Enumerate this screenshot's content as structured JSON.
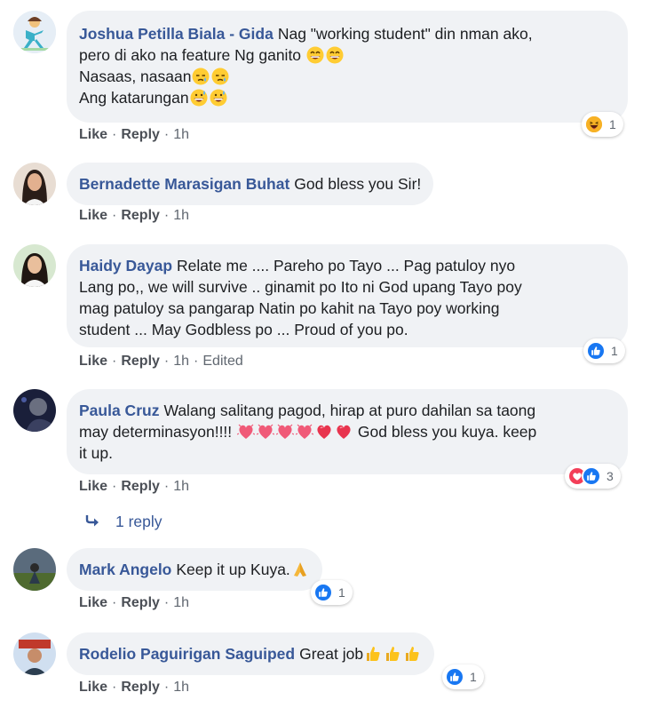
{
  "actions": {
    "like": "Like",
    "reply": "Reply",
    "edited": "Edited"
  },
  "comments": [
    {
      "author": "Joshua Petilla Biala - Gida",
      "lines": [
        "Nag \"working student\" din nman ako,",
        "pero di ako na feature Ng ganito",
        "Nasaas, nasaan",
        "Ang katarungan"
      ],
      "time": "1h",
      "reaction_count": "1",
      "reaction_types": [
        "haha"
      ]
    },
    {
      "author": "Bernadette Marasigan Buhat",
      "lines": [
        "God bless you Sir!"
      ],
      "time": "1h"
    },
    {
      "author": "Haidy Dayap",
      "lines": [
        "Relate me .... Pareho po Tayo ... Pag patuloy nyo",
        "Lang po,, we will survive .. ginamit po Ito ni God upang Tayo poy",
        "mag patuloy sa pangarap Natin po kahit na Tayo poy working",
        "student ... May Godbless po ... Proud of you po."
      ],
      "time": "1h",
      "edited": true,
      "reaction_count": "1",
      "reaction_types": [
        "like"
      ]
    },
    {
      "author": "Paula Cruz",
      "lines": [
        "Walang salitang pagod, hirap at puro dahilan sa taong",
        "may determinasyon!!!!",
        "God bless you kuya. keep",
        "it up."
      ],
      "time": "1h",
      "reaction_count": "3",
      "reaction_types": [
        "love",
        "like"
      ]
    },
    {
      "author": "Mark Angelo",
      "lines": [
        "Keep it up Kuya."
      ],
      "time": "1h",
      "reaction_count": "1",
      "reaction_types": [
        "like"
      ]
    },
    {
      "author": "Rodelio Paguirigan Saguiped",
      "lines": [
        "Great job"
      ],
      "time": "1h",
      "reaction_count": "1",
      "reaction_types": [
        "like"
      ]
    }
  ],
  "replies_link": "1 reply",
  "colors": {
    "author": "#385898",
    "bubble": "#f0f2f5",
    "like": "#1877f2",
    "love": "#f33e58",
    "haha": "#f7b125"
  }
}
